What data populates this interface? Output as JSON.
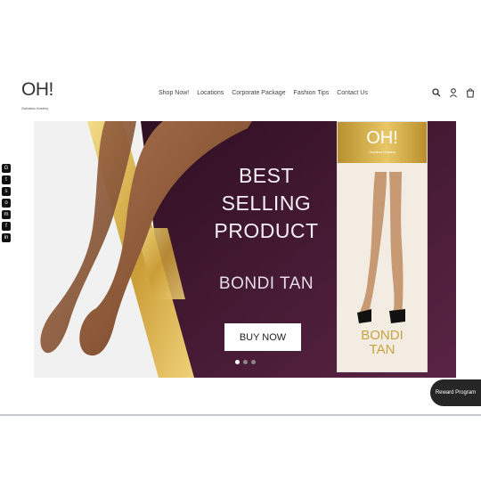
{
  "header": {
    "logo_text": "OH!",
    "logo_subtitle": "Oshalisa Hosiery",
    "nav": [
      "Shop Now!",
      "Locations",
      "Corporate Package",
      "Fashion Tips",
      "Contact Us"
    ],
    "icons": [
      "search-icon",
      "user-icon",
      "cart-icon"
    ]
  },
  "hero": {
    "headline": [
      "BEST",
      "SELLING",
      "PRODUCT"
    ],
    "product_name": "BONDI TAN",
    "cta_label": "BUY NOW",
    "slides_total": 3,
    "active_slide": 1,
    "package": {
      "logo": "OH!",
      "subtitle": "Oshalisa Hosiery",
      "name_line1": "BONDI",
      "name_line2": "TAN"
    },
    "colors": {
      "background": "#4d1c38",
      "gold": "#d9b54f"
    }
  },
  "social": [
    "google-plus-icon",
    "twitter-icon",
    "snapchat-icon",
    "instagram-icon",
    "messenger-icon",
    "facebook-icon",
    "linkedin-icon"
  ],
  "reward_button_label": "Reward Program"
}
